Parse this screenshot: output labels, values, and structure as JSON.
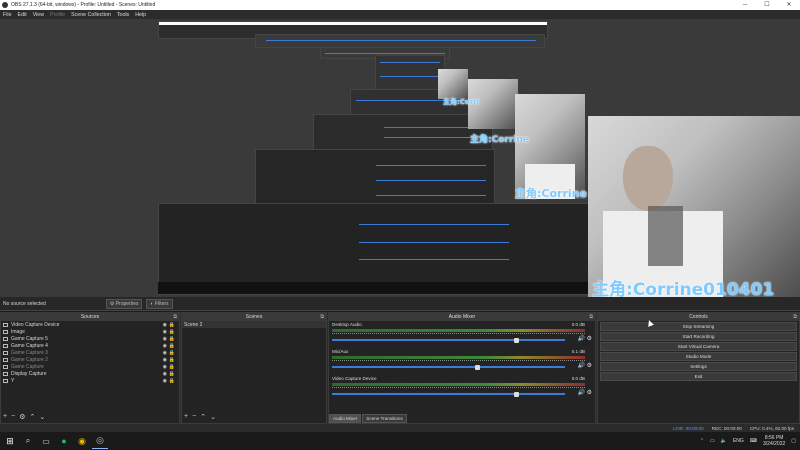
{
  "window": {
    "title": "OBS 27.1.3 (64-bit, windows) - Profile: Untitled - Scenes: Untitled"
  },
  "menu": [
    {
      "label": "File",
      "disabled": false
    },
    {
      "label": "Edit",
      "disabled": false
    },
    {
      "label": "View",
      "disabled": false
    },
    {
      "label": "Profile",
      "disabled": true
    },
    {
      "label": "Scene Collection",
      "disabled": false
    },
    {
      "label": "Tools",
      "disabled": false
    },
    {
      "label": "Help",
      "disabled": false
    }
  ],
  "preview": {
    "overlay_text": "主角:Corrine010401",
    "overlay_text_short": "主角:Corrine",
    "overlay_text_mid": "主角:Corri"
  },
  "properties_bar": {
    "status": "No source selected",
    "properties_label": "Properties",
    "filters_label": "Filters"
  },
  "sources": {
    "title": "Sources",
    "items": [
      {
        "label": "Video Capture Device",
        "icon": "camera-icon",
        "dim": false
      },
      {
        "label": "Image",
        "icon": "image-icon",
        "dim": false
      },
      {
        "label": "Game Capture 5",
        "icon": "gamepad-icon",
        "dim": false
      },
      {
        "label": "Game Capture 4",
        "icon": "gamepad-icon",
        "dim": false
      },
      {
        "label": "Game Capture 3",
        "icon": "gamepad-icon",
        "dim": true
      },
      {
        "label": "Game Capture 2",
        "icon": "gamepad-icon",
        "dim": true
      },
      {
        "label": "Game Capture",
        "icon": "gamepad-icon",
        "dim": true
      },
      {
        "label": "Display Capture",
        "icon": "monitor-icon",
        "dim": false
      },
      {
        "label": "Y",
        "icon": "monitor-icon",
        "dim": false
      }
    ]
  },
  "scenes": {
    "title": "Scenes",
    "items": [
      "Scene 2"
    ]
  },
  "mixer": {
    "title": "Audio Mixer",
    "channels": [
      {
        "name": "Desktop Audio",
        "db": "0.0 dB",
        "level": 0.79
      },
      {
        "name": "Mic/Aux",
        "db": "0.1 dB",
        "level": 0.62
      },
      {
        "name": "Video Capture Device",
        "db": "0.0 dB",
        "level": 0.79
      }
    ],
    "tabs": [
      "Audio Mixer",
      "Scene Transitions"
    ]
  },
  "controls": {
    "title": "Controls",
    "buttons": [
      "Stop Streaming",
      "Start Recording",
      "Start Virtual Camera",
      "Studio Mode",
      "Settings",
      "Exit"
    ]
  },
  "status": {
    "live": "LIVE: 00:00:00",
    "rec": "REC: 00:00:00",
    "cpu": "CPU: 0.4%, 60.00 fps"
  },
  "taskbar": {
    "lang": "ENG",
    "time": "8:56 PM",
    "date": "3/24/2022"
  },
  "colors": {
    "accent": "#3d7bd8",
    "overlay_text": "#7ecbff"
  }
}
